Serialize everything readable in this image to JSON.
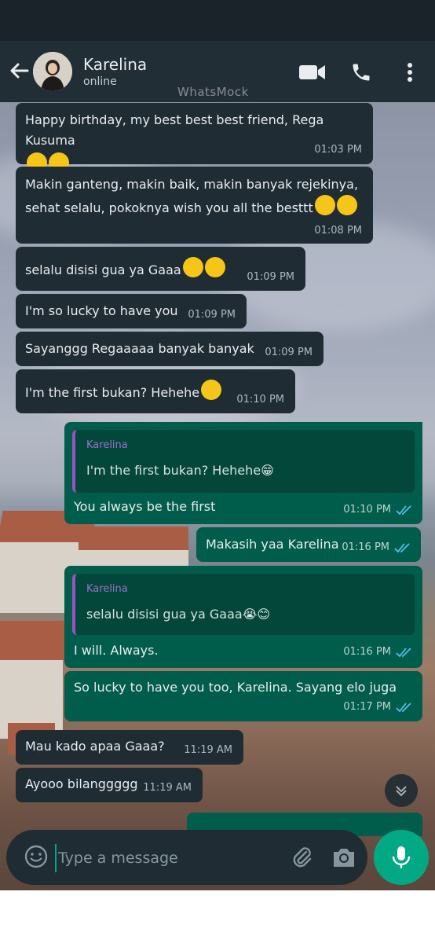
{
  "header": {
    "contact_name": "Karelina",
    "contact_status": "online",
    "watermark": "WhatsMock",
    "icons": [
      "back-arrow-icon",
      "video-call-icon",
      "phone-call-icon",
      "more-options-icon"
    ]
  },
  "messages": [
    {
      "direction": "in",
      "text": "Happy birthday, my best best best friend, Rega Kusuma",
      "emoji": [
        "☺️",
        "☺️"
      ],
      "time": "01:03 PM"
    },
    {
      "direction": "in",
      "text": "Makin ganteng, makin baik, makin banyak rejekinya, sehat selalu, pokoknya wish you all the besttt",
      "emoji": [
        "☺️",
        "☺️"
      ],
      "time": "01:08 PM"
    },
    {
      "direction": "in",
      "text": "selalu disisi gua ya Gaaa",
      "emoji": [
        "😭",
        "☺️"
      ],
      "time": "01:09 PM"
    },
    {
      "direction": "in",
      "text": "I'm so lucky to have you",
      "time": "01:09 PM"
    },
    {
      "direction": "in",
      "text": "Sayanggg Regaaaaa banyak banyak",
      "time": "01:09 PM"
    },
    {
      "direction": "in",
      "text": "I'm the first bukan? Hehehe",
      "emoji": [
        "😁"
      ],
      "time": "01:10 PM"
    },
    {
      "direction": "out",
      "reply_author": "Karelina",
      "reply_text": "I'm the first bukan? Hehehe😁",
      "text": "You always be the first",
      "time": "01:10 PM",
      "read": true
    },
    {
      "direction": "out",
      "text": "Makasih yaa Karelina",
      "time": "01:16 PM",
      "read": true
    },
    {
      "direction": "out",
      "reply_author": "Karelina",
      "reply_text": "selalu disisi gua ya Gaaa😭😊",
      "text": "I will. Always.",
      "time": "01:16 PM",
      "read": true
    },
    {
      "direction": "out",
      "text": "So lucky to have you too, Karelina. Sayang elo juga",
      "time": "01:17 PM",
      "read": true
    },
    {
      "direction": "in",
      "text": "Mau kado apaa Gaaa?",
      "time": "11:19 AM"
    },
    {
      "direction": "in",
      "text": "Ayooo bilanggggg",
      "time": "11:19 AM"
    }
  ],
  "composer": {
    "placeholder": "Type a message",
    "icons": [
      "emoji-icon",
      "attach-icon",
      "camera-icon",
      "mic-icon"
    ]
  },
  "colors": {
    "header_bg": "#222e35",
    "incoming_bubble": "#1f2c33",
    "outgoing_bubble": "#005c4b",
    "accent": "#00a884",
    "read_ticks": "#53bdeb",
    "quote_bar": "#9d4fc4"
  }
}
